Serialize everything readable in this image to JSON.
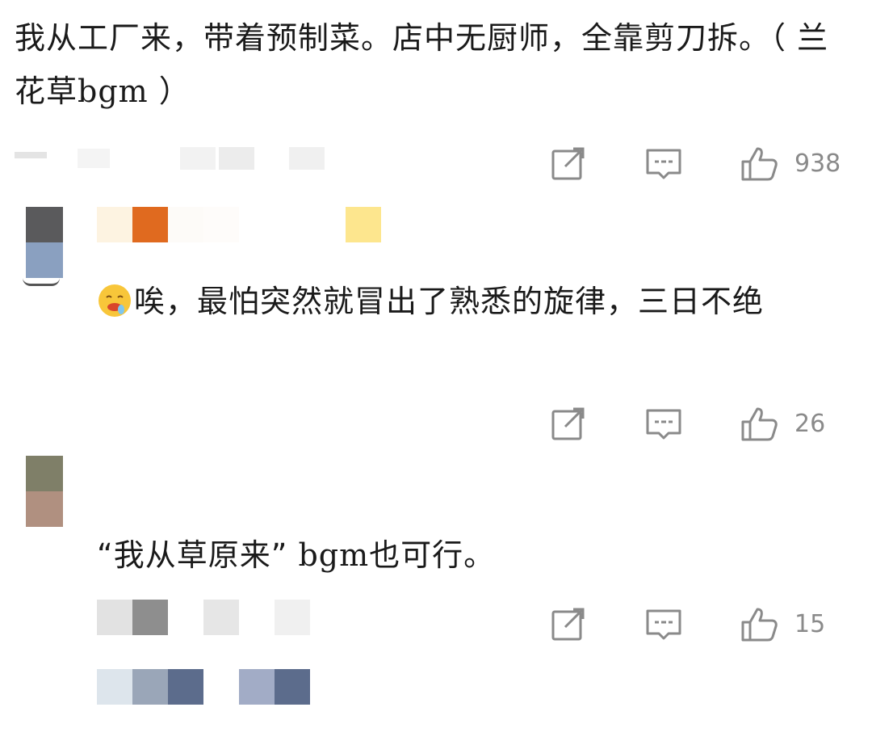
{
  "post": {
    "text": "我从工厂来，带着预制菜。店中无厨师，全靠剪刀拆。（ 兰花草bgm ）",
    "like_count": "938"
  },
  "replies": [
    {
      "text_after_emoji": "唉，最怕突然就冒出了熟悉的旋律，三日不绝",
      "emoji": "drooling-face-emoji",
      "like_count": "26"
    },
    {
      "quote_open": "“",
      "quoted": "我从草原来",
      "quote_close": "”",
      "rest": " bgm也可行。",
      "like_count": "15"
    }
  ],
  "icons": {
    "share": "share-icon",
    "comment": "comment-icon",
    "like": "thumbs-up-icon"
  },
  "colors": {
    "icon_gray": "#8a8a8a",
    "text": "#1a1a1a"
  }
}
